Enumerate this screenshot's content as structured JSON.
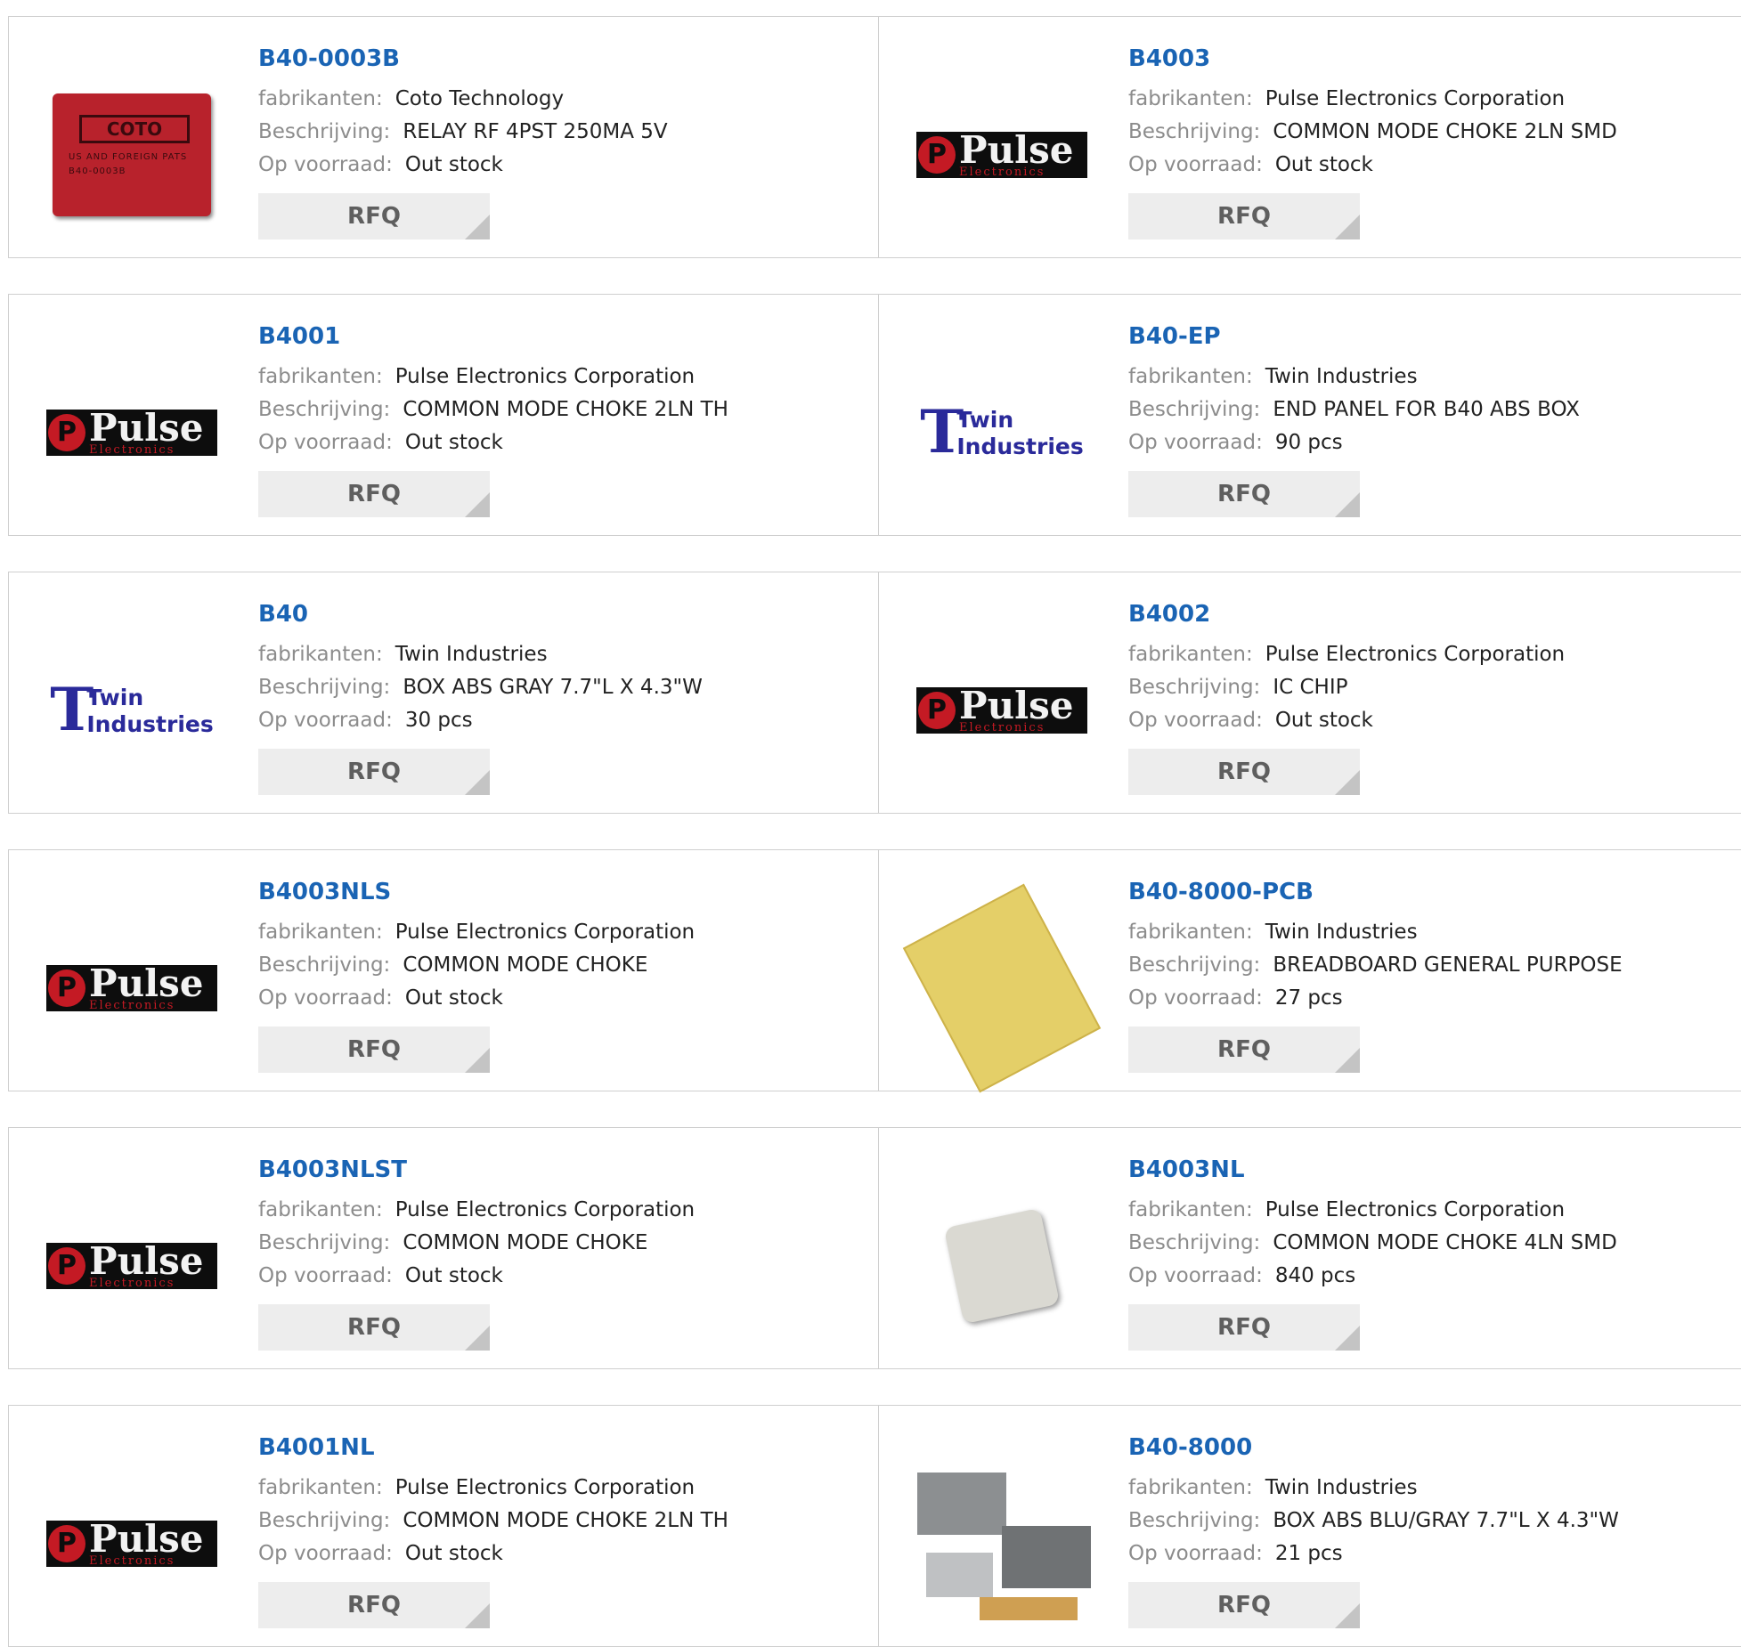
{
  "labels": {
    "manufacturer": "fabrikanten:",
    "description": "Beschrijving:",
    "stock": "Op voorraad:",
    "rfq": "RFQ"
  },
  "logos": {
    "pulse_word": "Pulse",
    "pulse_sub": "Electronics",
    "twin_line1": "Twin",
    "twin_line2": "Industries",
    "coto_mark": "COTO",
    "coto_t1": "US AND FOREIGN PATS",
    "coto_t2": "B40-0003B"
  },
  "products": [
    {
      "part": "B40-0003B",
      "manufacturer": "Coto Technology",
      "description": "RELAY RF 4PST 250MA 5V",
      "stock": "Out stock",
      "image": "coto"
    },
    {
      "part": "B4003",
      "manufacturer": "Pulse Electronics Corporation",
      "description": "COMMON MODE CHOKE 2LN SMD",
      "stock": "Out stock",
      "image": "pulse"
    },
    {
      "part": "B4001",
      "manufacturer": "Pulse Electronics Corporation",
      "description": "COMMON MODE CHOKE 2LN TH",
      "stock": "Out stock",
      "image": "pulse"
    },
    {
      "part": "B40-EP",
      "manufacturer": "Twin Industries",
      "description": "END PANEL FOR B40 ABS BOX",
      "stock": "90 pcs",
      "image": "twin"
    },
    {
      "part": "B40",
      "manufacturer": "Twin Industries",
      "description": "BOX ABS GRAY 7.7\"L X 4.3\"W",
      "stock": "30 pcs",
      "image": "twin"
    },
    {
      "part": "B4002",
      "manufacturer": "Pulse Electronics Corporation",
      "description": "IC CHIP",
      "stock": "Out stock",
      "image": "pulse"
    },
    {
      "part": "B4003NLS",
      "manufacturer": "Pulse Electronics Corporation",
      "description": "COMMON MODE CHOKE",
      "stock": "Out stock",
      "image": "pulse"
    },
    {
      "part": "B40-8000-PCB",
      "manufacturer": "Twin Industries",
      "description": "BREADBOARD GENERAL PURPOSE",
      "stock": "27 pcs",
      "image": "pcb"
    },
    {
      "part": "B4003NLST",
      "manufacturer": "Pulse Electronics Corporation",
      "description": "COMMON MODE CHOKE",
      "stock": "Out stock",
      "image": "pulse"
    },
    {
      "part": "B4003NL",
      "manufacturer": "Pulse Electronics Corporation",
      "description": "COMMON MODE CHOKE 4LN SMD",
      "stock": "840 pcs",
      "image": "choke"
    },
    {
      "part": "B4001NL",
      "manufacturer": "Pulse Electronics Corporation",
      "description": "COMMON MODE CHOKE 2LN TH",
      "stock": "Out stock",
      "image": "pulse"
    },
    {
      "part": "B40-8000",
      "manufacturer": "Twin Industries",
      "description": "BOX ABS BLU/GRAY 7.7\"L X 4.3\"W",
      "stock": "21 pcs",
      "image": "enclosure"
    }
  ],
  "colors": {
    "part_link": "#1a64b4",
    "label": "#8c8c8c",
    "value": "#222222",
    "rfq_bg": "#ededed",
    "rfq_text": "#5f5f5f",
    "border": "#cfcfcf"
  }
}
